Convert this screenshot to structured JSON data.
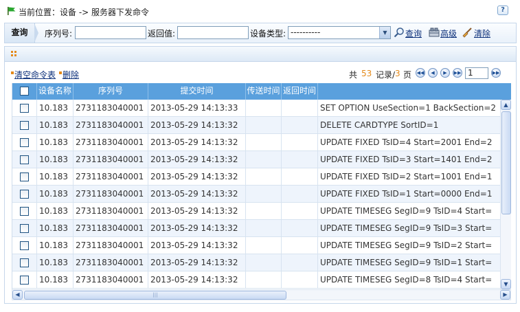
{
  "breadcrumb": {
    "text": "当前位置：设备  -> 服务器下发命令"
  },
  "help": {
    "label": "?"
  },
  "query_bar": {
    "tab_label": "查询",
    "serial_label": "序列号:",
    "serial_value": "",
    "return_label": "返回值:",
    "return_value": "",
    "device_type_label": "设备类型:",
    "device_type_value": "----------",
    "search_label": "查询",
    "advanced_label": "高级",
    "clear_label": "清除"
  },
  "actions": {
    "clear_table": "清空命令表",
    "delete": "删除"
  },
  "pager": {
    "prefix": "共",
    "total": "53",
    "mid": "记录/",
    "pages": "3",
    "suffix": "页",
    "current": "1"
  },
  "table": {
    "columns": [
      "设备名称",
      "序列号",
      "提交时间",
      "传送时间",
      "返回时间",
      ""
    ],
    "rows": [
      {
        "name": "10.183",
        "serial": "2731183040001",
        "submit": "2013-05-29 14:13:33",
        "sent": "",
        "returned": "",
        "command": "SET OPTION UseSection=1 BackSection=2"
      },
      {
        "name": "10.183",
        "serial": "2731183040001",
        "submit": "2013-05-29 14:13:32",
        "sent": "",
        "returned": "",
        "command": "DELETE CARDTYPE SortID=1"
      },
      {
        "name": "10.183",
        "serial": "2731183040001",
        "submit": "2013-05-29 14:13:32",
        "sent": "",
        "returned": "",
        "command": "UPDATE FIXED TsID=4 Start=2001 End=2"
      },
      {
        "name": "10.183",
        "serial": "2731183040001",
        "submit": "2013-05-29 14:13:32",
        "sent": "",
        "returned": "",
        "command": "UPDATE FIXED TsID=3 Start=1401 End=2"
      },
      {
        "name": "10.183",
        "serial": "2731183040001",
        "submit": "2013-05-29 14:13:32",
        "sent": "",
        "returned": "",
        "command": "UPDATE FIXED TsID=2 Start=1001 End=1"
      },
      {
        "name": "10.183",
        "serial": "2731183040001",
        "submit": "2013-05-29 14:13:32",
        "sent": "",
        "returned": "",
        "command": "UPDATE FIXED TsID=1 Start=0000 End=1"
      },
      {
        "name": "10.183",
        "serial": "2731183040001",
        "submit": "2013-05-29 14:13:32",
        "sent": "",
        "returned": "",
        "command": "UPDATE TIMESEG SegID=9 TsID=4 Start="
      },
      {
        "name": "10.183",
        "serial": "2731183040001",
        "submit": "2013-05-29 14:13:32",
        "sent": "",
        "returned": "",
        "command": "UPDATE TIMESEG SegID=9 TsID=3 Start="
      },
      {
        "name": "10.183",
        "serial": "2731183040001",
        "submit": "2013-05-29 14:13:32",
        "sent": "",
        "returned": "",
        "command": "UPDATE TIMESEG SegID=9 TsID=2 Start="
      },
      {
        "name": "10.183",
        "serial": "2731183040001",
        "submit": "2013-05-29 14:13:32",
        "sent": "",
        "returned": "",
        "command": "UPDATE TIMESEG SegID=9 TsID=1 Start="
      },
      {
        "name": "10.183",
        "serial": "2731183040001",
        "submit": "2013-05-29 14:13:32",
        "sent": "",
        "returned": "",
        "command": "UPDATE TIMESEG SegID=8 TsID=4 Start="
      }
    ]
  },
  "colors": {
    "header": "#5aa0dd",
    "accent": "#e48a1a",
    "link": "#0b2f7a",
    "alt_row": "#eef4fc"
  }
}
